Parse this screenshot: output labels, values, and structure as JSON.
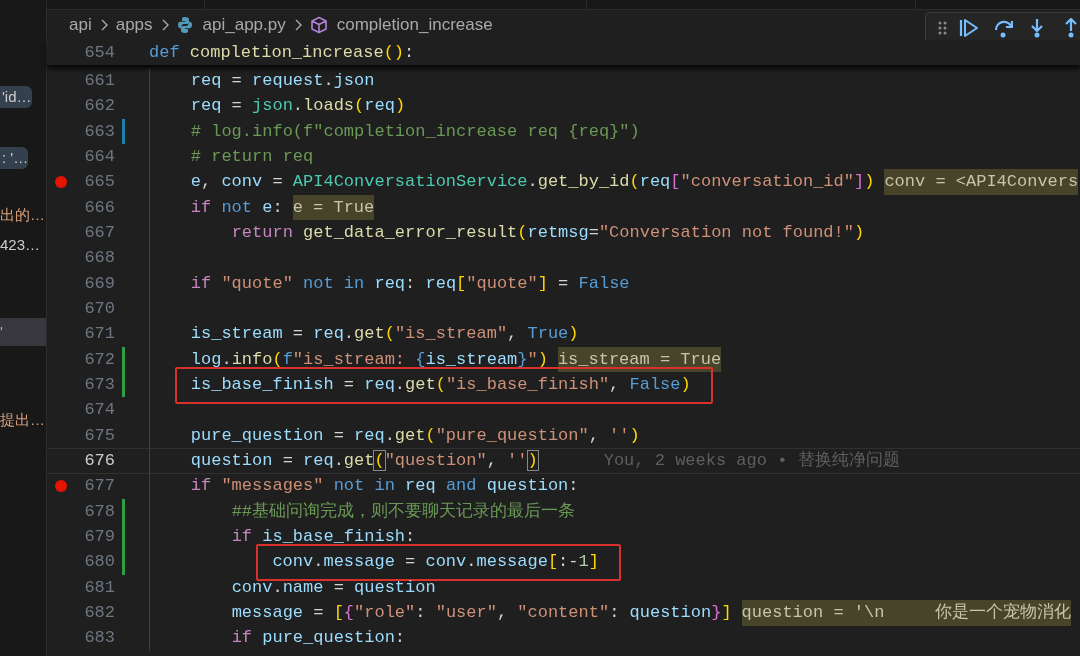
{
  "variables_panel": [
    {
      "text": "'id…",
      "kind": "hover",
      "selected": false
    },
    {
      "text": ": '…",
      "kind": "hover",
      "selected": false
    },
    {
      "text": "出的…",
      "kind": "string",
      "selected": false
    },
    {
      "text": "423…",
      "kind": "value",
      "selected": false
    },
    {
      "text": "'",
      "kind": "string",
      "selected": true
    },
    {
      "text": "提出…",
      "kind": "string",
      "selected": false
    }
  ],
  "breadcrumb": [
    {
      "text": "api",
      "kind": "folder"
    },
    {
      "text": "apps",
      "kind": "folder"
    },
    {
      "text": "api_app.py",
      "kind": "python_file"
    },
    {
      "text": "completion_increase",
      "kind": "method"
    }
  ],
  "debug_toolbar": {
    "buttons": [
      {
        "kind": "continue"
      },
      {
        "kind": "step_over"
      },
      {
        "kind": "step_into"
      },
      {
        "kind": "step_out"
      }
    ]
  },
  "sticky_line": {
    "number": "654",
    "tokens": [
      {
        "kind": "kw",
        "text": "def "
      },
      {
        "kind": "fn",
        "text": "completion_increase"
      },
      {
        "kind": "b1",
        "text": "()"
      },
      {
        "kind": "op",
        "text": ":"
      }
    ]
  },
  "lines": [
    {
      "number": "661",
      "breakpoint": false,
      "current": false,
      "boxed": false,
      "tokens": [
        {
          "kind": "var",
          "text": "    req"
        },
        {
          "kind": "op",
          "text": " = "
        },
        {
          "kind": "var",
          "text": "request"
        },
        {
          "kind": "op",
          "text": "."
        },
        {
          "kind": "var",
          "text": "json"
        }
      ]
    },
    {
      "number": "662",
      "breakpoint": false,
      "current": false,
      "boxed": false,
      "tokens": [
        {
          "kind": "var",
          "text": "    req"
        },
        {
          "kind": "op",
          "text": " = "
        },
        {
          "kind": "cls",
          "text": "json"
        },
        {
          "kind": "op",
          "text": "."
        },
        {
          "kind": "fn",
          "text": "loads"
        },
        {
          "kind": "b1",
          "text": "("
        },
        {
          "kind": "var",
          "text": "req"
        },
        {
          "kind": "b1",
          "text": ")"
        }
      ]
    },
    {
      "number": "663",
      "breakpoint": false,
      "current": false,
      "boxed": false,
      "color": "#1b81a8",
      "tokens": [
        {
          "kind": "com",
          "text": "    # log.info(f\"completion_increase req {req}\")"
        }
      ]
    },
    {
      "number": "664",
      "breakpoint": false,
      "current": false,
      "boxed": false,
      "tokens": [
        {
          "kind": "com",
          "text": "    # return req"
        }
      ]
    },
    {
      "number": "665",
      "breakpoint": true,
      "current": false,
      "boxed": false,
      "inline_value": "conv = <API4Convers",
      "tokens": [
        {
          "kind": "var",
          "text": "    e"
        },
        {
          "kind": "op",
          "text": ", "
        },
        {
          "kind": "var",
          "text": "conv"
        },
        {
          "kind": "op",
          "text": " = "
        },
        {
          "kind": "cls",
          "text": "API4ConversationService"
        },
        {
          "kind": "op",
          "text": "."
        },
        {
          "kind": "fn",
          "text": "get_by_id"
        },
        {
          "kind": "b1",
          "text": "("
        },
        {
          "kind": "var",
          "text": "req"
        },
        {
          "kind": "b2",
          "text": "["
        },
        {
          "kind": "str",
          "text": "\"conversation_id\""
        },
        {
          "kind": "b2",
          "text": "]"
        },
        {
          "kind": "b1",
          "text": ")"
        }
      ]
    },
    {
      "number": "666",
      "breakpoint": false,
      "current": false,
      "boxed": false,
      "inline_value": "e = True",
      "tokens": [
        {
          "kind": "ctl",
          "text": "    if "
        },
        {
          "kind": "kw",
          "text": "not "
        },
        {
          "kind": "var",
          "text": "e"
        },
        {
          "kind": "op",
          "text": ":"
        }
      ]
    },
    {
      "number": "667",
      "breakpoint": false,
      "current": false,
      "boxed": false,
      "tokens": [
        {
          "kind": "ctl",
          "text": "        return "
        },
        {
          "kind": "fn",
          "text": "get_data_error_result"
        },
        {
          "kind": "b1",
          "text": "("
        },
        {
          "kind": "var",
          "text": "retmsg"
        },
        {
          "kind": "op",
          "text": "="
        },
        {
          "kind": "str",
          "text": "\"Conversation not found!\""
        },
        {
          "kind": "b1",
          "text": ")"
        }
      ]
    },
    {
      "number": "668",
      "breakpoint": false,
      "current": false,
      "boxed": false
    },
    {
      "number": "669",
      "breakpoint": false,
      "current": false,
      "boxed": false,
      "tokens": [
        {
          "kind": "ctl",
          "text": "    if "
        },
        {
          "kind": "str",
          "text": "\"quote\" "
        },
        {
          "kind": "kw",
          "text": "not in "
        },
        {
          "kind": "var",
          "text": "req"
        },
        {
          "kind": "op",
          "text": ": "
        },
        {
          "kind": "var",
          "text": "req"
        },
        {
          "kind": "b1",
          "text": "["
        },
        {
          "kind": "str",
          "text": "\"quote\""
        },
        {
          "kind": "b1",
          "text": "]"
        },
        {
          "kind": "op",
          "text": " = "
        },
        {
          "kind": "kw",
          "text": "False"
        }
      ]
    },
    {
      "number": "670",
      "breakpoint": false,
      "current": false,
      "boxed": false
    },
    {
      "number": "671",
      "breakpoint": false,
      "current": false,
      "boxed": false,
      "tokens": [
        {
          "kind": "var",
          "text": "    is_stream"
        },
        {
          "kind": "op",
          "text": " = "
        },
        {
          "kind": "var",
          "text": "req"
        },
        {
          "kind": "op",
          "text": "."
        },
        {
          "kind": "fn",
          "text": "get"
        },
        {
          "kind": "b1",
          "text": "("
        },
        {
          "kind": "str",
          "text": "\"is_stream\""
        },
        {
          "kind": "op",
          "text": ", "
        },
        {
          "kind": "kw",
          "text": "True"
        },
        {
          "kind": "b1",
          "text": ")"
        }
      ]
    },
    {
      "number": "672",
      "breakpoint": false,
      "current": false,
      "boxed": false,
      "color": "#2ea043",
      "inline_value": "is_stream = True",
      "tokens": [
        {
          "kind": "var",
          "text": "    log"
        },
        {
          "kind": "op",
          "text": "."
        },
        {
          "kind": "fn",
          "text": "info"
        },
        {
          "kind": "b1",
          "text": "("
        },
        {
          "kind": "kw",
          "text": "f"
        },
        {
          "kind": "str",
          "text": "\"is_stream: "
        },
        {
          "kind": "kw",
          "text": "{"
        },
        {
          "kind": "var",
          "text": "is_stream"
        },
        {
          "kind": "kw",
          "text": "}"
        },
        {
          "kind": "str",
          "text": "\""
        },
        {
          "kind": "b1",
          "text": ")"
        }
      ]
    },
    {
      "number": "673",
      "breakpoint": false,
      "current": false,
      "boxed": true,
      "color": "#2ea043",
      "tokens": [
        {
          "kind": "var",
          "text": "    is_base_finish"
        },
        {
          "kind": "op",
          "text": " = "
        },
        {
          "kind": "var",
          "text": "req"
        },
        {
          "kind": "op",
          "text": "."
        },
        {
          "kind": "fn",
          "text": "get"
        },
        {
          "kind": "b1",
          "text": "("
        },
        {
          "kind": "str",
          "text": "\"is_base_finish\""
        },
        {
          "kind": "op",
          "text": ", "
        },
        {
          "kind": "kw",
          "text": "False"
        },
        {
          "kind": "b1",
          "text": ")"
        }
      ]
    },
    {
      "number": "674",
      "breakpoint": false,
      "current": false,
      "boxed": false
    },
    {
      "number": "675",
      "breakpoint": false,
      "current": false,
      "boxed": false,
      "tokens": [
        {
          "kind": "var",
          "text": "    pure_question"
        },
        {
          "kind": "op",
          "text": " = "
        },
        {
          "kind": "var",
          "text": "req"
        },
        {
          "kind": "op",
          "text": "."
        },
        {
          "kind": "fn",
          "text": "get"
        },
        {
          "kind": "b1",
          "text": "("
        },
        {
          "kind": "str",
          "text": "\"pure_question\""
        },
        {
          "kind": "op",
          "text": ", "
        },
        {
          "kind": "str",
          "text": "''"
        },
        {
          "kind": "b1",
          "text": ")"
        }
      ]
    },
    {
      "number": "676",
      "breakpoint": false,
      "current": true,
      "boxed": false,
      "blame": "You, 2 weeks ago • 替换纯净问题",
      "tokens": [
        {
          "kind": "var",
          "text": "    question"
        },
        {
          "kind": "op",
          "text": " = "
        },
        {
          "kind": "var",
          "text": "req"
        },
        {
          "kind": "op",
          "text": "."
        },
        {
          "kind": "fn",
          "text": "get"
        },
        {
          "kind": "bm",
          "text": "("
        },
        {
          "kind": "str",
          "text": "\"question\""
        },
        {
          "kind": "op",
          "text": ", "
        },
        {
          "kind": "str",
          "text": "''"
        },
        {
          "kind": "bm",
          "text": ")"
        }
      ]
    },
    {
      "number": "677",
      "breakpoint": true,
      "current": false,
      "boxed": false,
      "tokens": [
        {
          "kind": "ctl",
          "text": "    if "
        },
        {
          "kind": "str",
          "text": "\"messages\" "
        },
        {
          "kind": "kw",
          "text": "not in "
        },
        {
          "kind": "var",
          "text": "req "
        },
        {
          "kind": "kw",
          "text": "and "
        },
        {
          "kind": "var",
          "text": "question"
        },
        {
          "kind": "op",
          "text": ":"
        }
      ]
    },
    {
      "number": "678",
      "breakpoint": false,
      "current": false,
      "boxed": false,
      "color": "#2ea043",
      "tokens": [
        {
          "kind": "com",
          "text": "        ##基础问询完成，则不要聊天记录的最后一条"
        }
      ]
    },
    {
      "number": "679",
      "breakpoint": false,
      "current": false,
      "boxed": false,
      "color": "#2ea043",
      "tokens": [
        {
          "kind": "ctl",
          "text": "        if "
        },
        {
          "kind": "var",
          "text": "is_base_finish"
        },
        {
          "kind": "op",
          "text": ":"
        }
      ]
    },
    {
      "number": "680",
      "breakpoint": false,
      "current": false,
      "boxed": true,
      "color": "#2ea043",
      "tokens": [
        {
          "kind": "var",
          "text": "            conv"
        },
        {
          "kind": "op",
          "text": "."
        },
        {
          "kind": "var",
          "text": "message"
        },
        {
          "kind": "op",
          "text": " = "
        },
        {
          "kind": "var",
          "text": "conv"
        },
        {
          "kind": "op",
          "text": "."
        },
        {
          "kind": "var",
          "text": "message"
        },
        {
          "kind": "b1",
          "text": "["
        },
        {
          "kind": "op",
          "text": ":-"
        },
        {
          "kind": "num",
          "text": "1"
        },
        {
          "kind": "b1",
          "text": "]"
        }
      ]
    },
    {
      "number": "681",
      "breakpoint": false,
      "current": false,
      "boxed": false,
      "tokens": [
        {
          "kind": "var",
          "text": "        conv"
        },
        {
          "kind": "op",
          "text": "."
        },
        {
          "kind": "var",
          "text": "name"
        },
        {
          "kind": "op",
          "text": " = "
        },
        {
          "kind": "var",
          "text": "question"
        }
      ]
    },
    {
      "number": "682",
      "breakpoint": false,
      "current": false,
      "boxed": false,
      "inline_value": "question = '\\n     你是一个宠物消化",
      "tokens": [
        {
          "kind": "var",
          "text": "        message"
        },
        {
          "kind": "op",
          "text": " = "
        },
        {
          "kind": "b1",
          "text": "["
        },
        {
          "kind": "b2",
          "text": "{"
        },
        {
          "kind": "str",
          "text": "\"role\""
        },
        {
          "kind": "op",
          "text": ": "
        },
        {
          "kind": "str",
          "text": "\"user\""
        },
        {
          "kind": "op",
          "text": ", "
        },
        {
          "kind": "str",
          "text": "\"content\""
        },
        {
          "kind": "op",
          "text": ": "
        },
        {
          "kind": "var",
          "text": "question"
        },
        {
          "kind": "b2",
          "text": "}"
        },
        {
          "kind": "b1",
          "text": "]"
        }
      ]
    },
    {
      "number": "683",
      "breakpoint": false,
      "current": false,
      "boxed": false,
      "tokens": [
        {
          "kind": "ctl",
          "text": "        if "
        },
        {
          "kind": "var",
          "text": "pure_question"
        },
        {
          "kind": "op",
          "text": ":"
        }
      ]
    }
  ]
}
